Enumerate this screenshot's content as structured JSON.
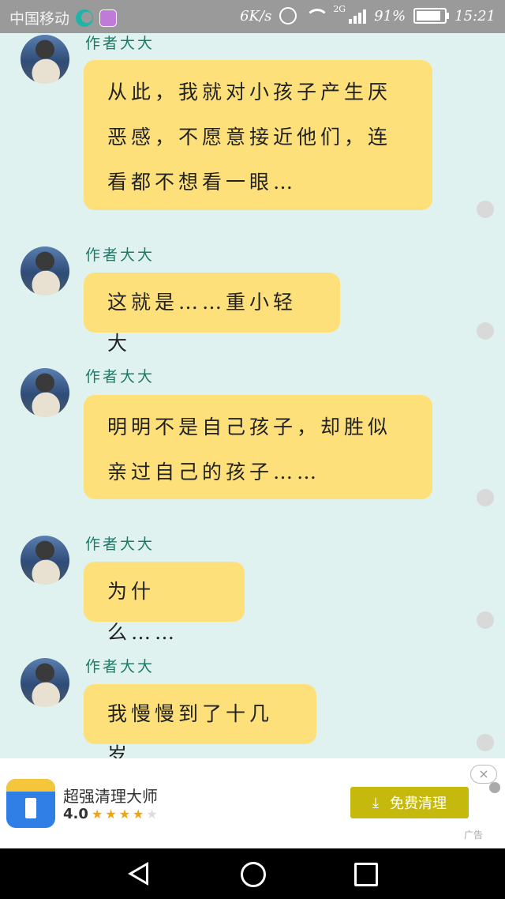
{
  "status_bar": {
    "carrier": "中国移动",
    "speed": "6K/s",
    "network": "2G",
    "battery": "91%",
    "time": "15:21"
  },
  "messages": [
    {
      "author": "作者大大",
      "text": "从此，我就对小孩子产生厌恶感，不愿意接近他们，连看都不想看一眼…"
    },
    {
      "author": "作者大大",
      "text": "这就是……重小轻大"
    },
    {
      "author": "作者大大",
      "text": "明明不是自己孩子，却胜似亲过自己的孩子……"
    },
    {
      "author": "作者大大",
      "text": "为什么……"
    },
    {
      "author": "作者大大",
      "text": "我慢慢到了十几岁"
    }
  ],
  "ad": {
    "app_name": "超强清理大师",
    "rating": "4.0",
    "stars_filled": 4,
    "stars_total": 5,
    "button_label": "免费清理",
    "close_label": "×",
    "ad_label": "广告",
    "accent": "#c5b90e"
  },
  "colors": {
    "bubble": "#fde07a",
    "background": "#dff2f0",
    "author": "#1e7a68"
  }
}
